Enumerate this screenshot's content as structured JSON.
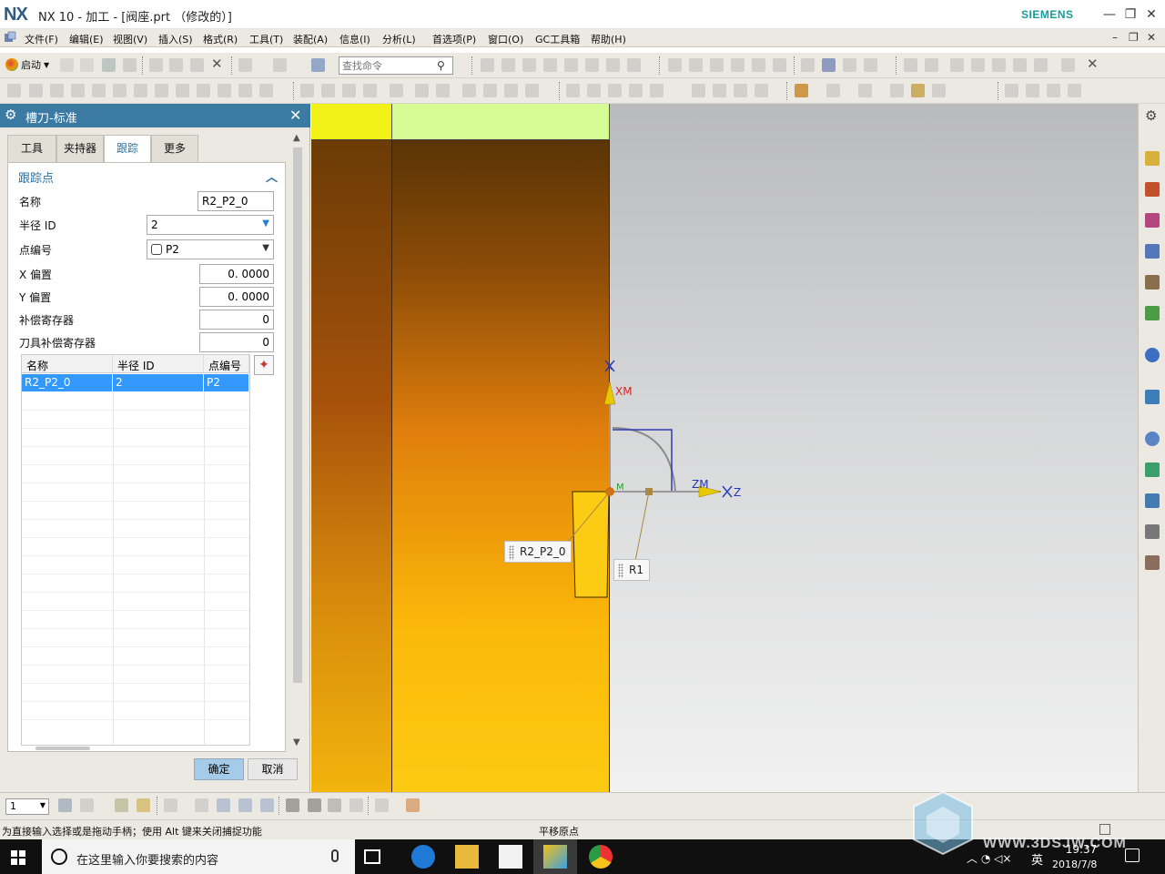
{
  "window": {
    "logo": "NX",
    "title": "NX 10 - 加工 - [阀座.prt （修改的）]",
    "brand": "SIEMENS"
  },
  "menu": [
    "文件(F)",
    "编辑(E)",
    "视图(V)",
    "插入(S)",
    "格式(R)",
    "工具(T)",
    "装配(A)",
    "信息(I)",
    "分析(L)",
    "首选项(P)",
    "窗口(O)",
    "GC工具箱",
    "帮助(H)"
  ],
  "toolbar": {
    "start_label": "启动",
    "search_placeholder": "查找命令"
  },
  "dialog": {
    "title": "槽刀-标准",
    "tabs": [
      "工具",
      "夹持器",
      "跟踪",
      "更多"
    ],
    "active_tab": "跟踪",
    "section_title": "跟踪点",
    "fields": {
      "name_label": "名称",
      "name_value": "R2_P2_0",
      "radius_id_label": "半径 ID",
      "radius_id_value": "2",
      "point_num_label": "点编号",
      "point_num_value": "P2",
      "x_offset_label": "X 偏置",
      "x_offset_value": "0. 0000",
      "y_offset_label": "Y 偏置",
      "y_offset_value": "0. 0000",
      "comp_reg_label": "补偿寄存器",
      "comp_reg_value": "0",
      "tool_comp_reg_label": "刀具补偿寄存器",
      "tool_comp_reg_value": "0"
    },
    "table": {
      "columns": [
        "名称",
        "半径 ID",
        "点编号"
      ],
      "rows": [
        {
          "name": "R2_P2_0",
          "radius_id": "2",
          "point": "P2"
        }
      ]
    },
    "ok_label": "确定",
    "cancel_label": "取消"
  },
  "viewport": {
    "axis_xm": "XM",
    "axis_zm": "ZM",
    "axis_z": "Z",
    "axis_x": "X",
    "axis_small_m": "M",
    "label_tracking_point": "R2_P2_0",
    "label_r1": "R1",
    "colors": {
      "blank_yellow": "#f2f218",
      "blank_green": "#d6fb94",
      "part_orange": "#e07f0c",
      "xm_axis": "#e8c800",
      "zm_axis": "#e8c800"
    }
  },
  "bottom": {
    "selection_filter": "1",
    "status_left": "为直接输入选择或是拖动手柄；使用 Alt 键来关闭捕捉功能",
    "status_mid": "平移原点"
  },
  "taskbar": {
    "search_text": "在这里输入你要搜索的内容",
    "ime": "英",
    "time": "19:37",
    "date": "2018/7/8"
  },
  "watermark": "WWW.3DSJW.COM"
}
